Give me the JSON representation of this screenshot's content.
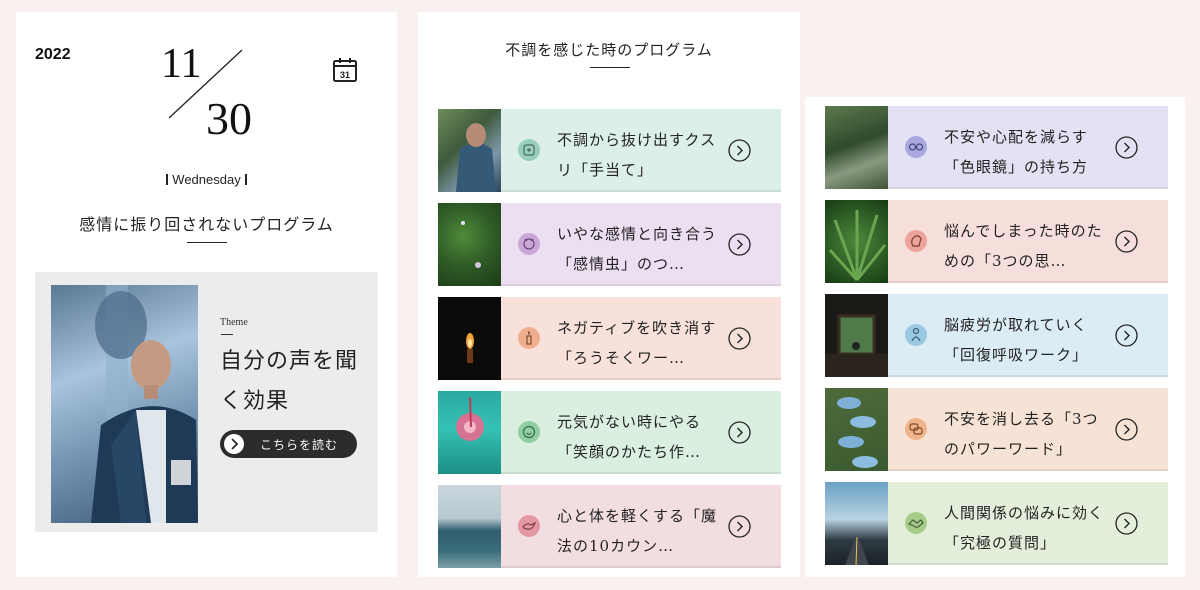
{
  "colors": {
    "page_background": "#f8f1f0",
    "card_teal": "#dcefe9",
    "card_lavender": "#ecdff1",
    "card_peach": "#f7e1da",
    "card_mint": "#dbefe0",
    "card_pink": "#f2dde1",
    "card_periwinkle": "#e2e2f4",
    "card_salmon": "#f6dedb",
    "card_sky": "#dcecf5",
    "card_apricot": "#f7e3d5",
    "card_green": "#e3eedb"
  },
  "date_panel": {
    "year": "2022",
    "month": "11",
    "day": "30",
    "calendar_icon_day": "31",
    "calendar_icon": "calendar-icon",
    "weekday": "Wednesday",
    "heading": "感情に振り回されないプログラム",
    "theme": {
      "label": "Theme",
      "title": "自分の声を聞く効果",
      "button_label": "こちらを読む"
    }
  },
  "program_list": {
    "heading": "不調を感じた時のプログラム"
  },
  "programs_left": [
    {
      "title": "不調から抜け出すクスリ「手当て」",
      "icon": "hands-care-icon"
    },
    {
      "title": "いやな感情と向き合う「感情虫」のつ…",
      "icon": "emotion-bug-icon"
    },
    {
      "title": "ネガティブを吹き消す「ろうそくワー…",
      "icon": "candle-icon"
    },
    {
      "title": "元気がない時にやる「笑顔のかたち作…",
      "icon": "smile-flower-icon"
    },
    {
      "title": "心と体を軽くする「魔法の10カウン…",
      "icon": "bird-icon"
    }
  ],
  "programs_right": [
    {
      "title": "不安や心配を減らす「色眼鏡」の持ち方",
      "icon": "glasses-icon"
    },
    {
      "title": "悩んでしまった時のための「3つの思…",
      "icon": "thinking-head-icon"
    },
    {
      "title": "脳疲労が取れていく「回復呼吸ワーク」",
      "icon": "breathing-person-icon"
    },
    {
      "title": "不安を消し去る「3つのパワーワード」",
      "icon": "speech-bubbles-icon"
    },
    {
      "title": "人間関係の悩みに効く「究極の質問」",
      "icon": "handshake-icon"
    }
  ]
}
